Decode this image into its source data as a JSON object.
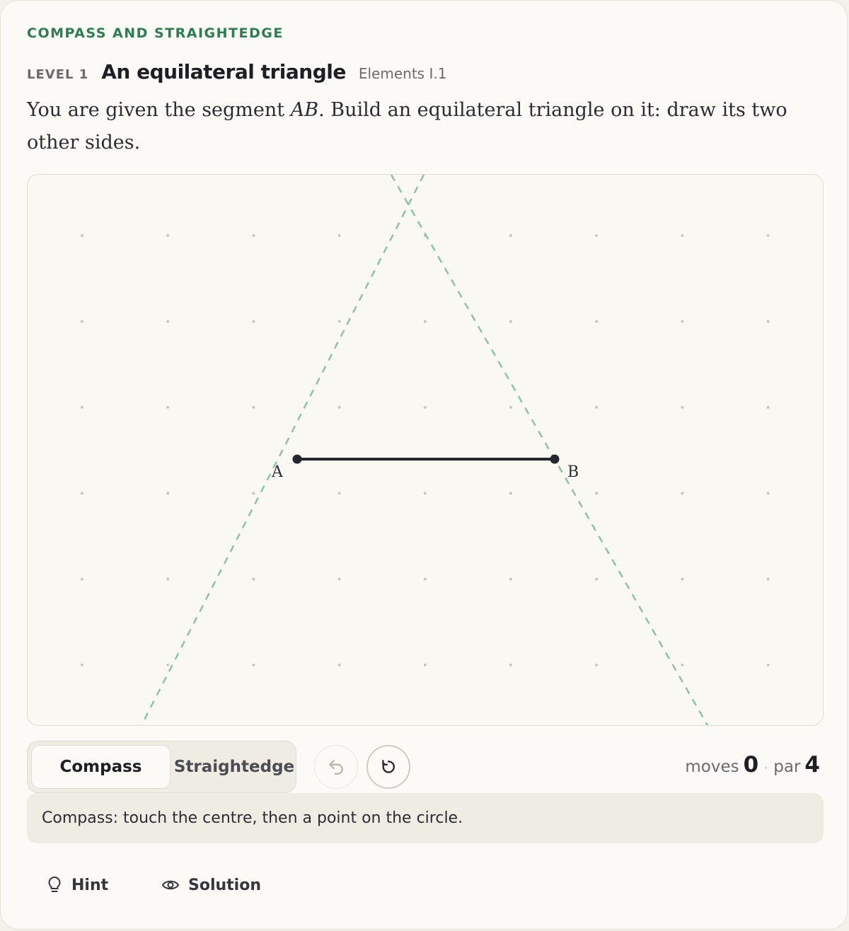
{
  "header": {
    "eyebrow": "COMPASS AND STRAIGHTEDGE",
    "level_label": "LEVEL 1",
    "level_title": "An equilateral triangle",
    "level_ref": "Elements I.1"
  },
  "prompt": {
    "before": "You are given the segment ",
    "math": "AB",
    "after": ". Build an equilateral triangle on it: draw its two other sides."
  },
  "board": {
    "point_a_label": "A",
    "point_b_label": "B",
    "colors": {
      "segment": "#23262d",
      "guide": "#8dc3a4",
      "grid_dot": "#c9c6bc"
    }
  },
  "toolbar": {
    "compass_label": "Compass",
    "straightedge_label": "Straightedge",
    "active_tool": "Compass",
    "undo_icon": "undo-icon",
    "reset_icon": "reset-icon"
  },
  "score": {
    "moves_label": "moves",
    "moves_value": "0",
    "separator": "·",
    "par_label": "par",
    "par_value": "4"
  },
  "status": {
    "message": "Compass: touch the centre, then a point on the circle."
  },
  "actions": {
    "hint_label": "Hint",
    "hint_icon": "lightbulb-icon",
    "solution_label": "Solution",
    "solution_icon": "eye-icon"
  },
  "theme": {
    "accent": "#2e7d50",
    "background": "#fbfaf6"
  }
}
